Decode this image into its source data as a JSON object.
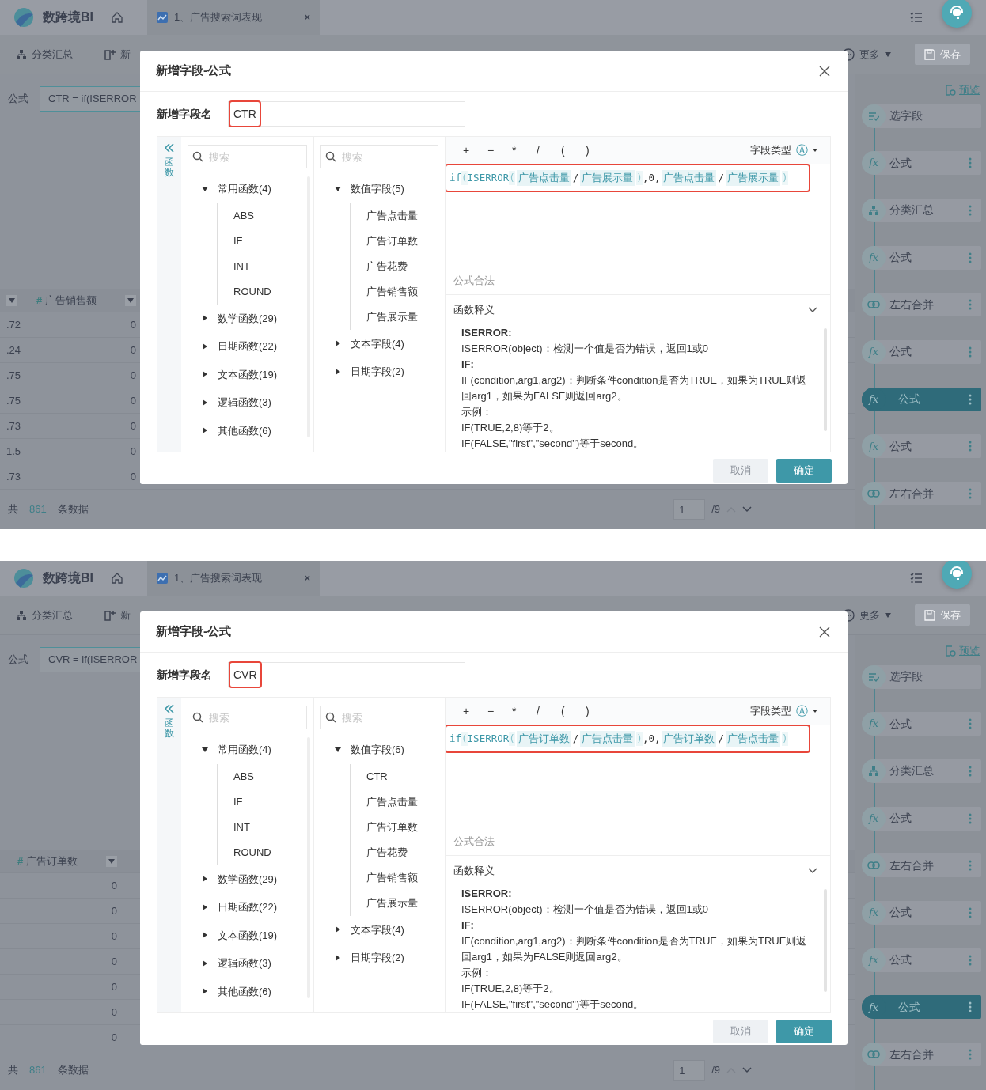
{
  "panels": [
    {
      "app": {
        "logo": "数跨境BI",
        "tab": "1、广告搜索词表现",
        "tab_close": "×"
      },
      "toolbar": {
        "items": [
          "分类汇总",
          "新"
        ],
        "more": "更多",
        "save": {
          "label": "保存",
          "disabled": true
        }
      },
      "formula_bar": {
        "label": "公式",
        "value": "CTR = if(ISERROR"
      },
      "table": {
        "column": {
          "type_mark": "#",
          "label": "广告销售额"
        },
        "rows": [
          {
            "cut_value": ".72",
            "value": "0"
          },
          {
            "cut_value": ".24",
            "value": "0"
          },
          {
            "cut_value": ".75",
            "value": "0"
          },
          {
            "cut_value": ".75",
            "value": "0"
          },
          {
            "cut_value": ".73",
            "value": "0"
          },
          {
            "cut_value": "1.5",
            "value": "0"
          },
          {
            "cut_value": ".73",
            "value": "0"
          }
        ]
      },
      "footer": {
        "prefix": "共",
        "count": "861",
        "suffix": "条数据",
        "page": "1",
        "total": "/9"
      },
      "pipeline": {
        "preview": "预览",
        "steps": [
          {
            "kind": "select",
            "label": "选字段",
            "selected": false
          },
          {
            "kind": "formula",
            "icon": "fx",
            "label": "公式",
            "selected": false
          },
          {
            "kind": "group",
            "label": "分类汇总",
            "selected": false
          },
          {
            "kind": "formula",
            "icon": "fx",
            "label": "公式",
            "selected": false
          },
          {
            "kind": "join",
            "label": "左右合并",
            "selected": false
          },
          {
            "kind": "formula",
            "icon": "fx",
            "label": "公式",
            "selected": false
          },
          {
            "kind": "formula",
            "icon": "fx",
            "label": "公式",
            "selected": true
          },
          {
            "kind": "formula",
            "icon": "fx",
            "label": "公式",
            "selected": false
          },
          {
            "kind": "join",
            "label": "左右合并",
            "selected": false
          }
        ]
      },
      "modal": {
        "title": "新增字段-公式",
        "name_label": "新增字段名",
        "name_value": "CTR",
        "functions": {
          "tab_label": "函数",
          "search_placeholder": "搜索",
          "groups": [
            {
              "label": "常用函数(4)",
              "expanded": true,
              "children": [
                {
                  "label": "ABS"
                },
                {
                  "label": "IF"
                },
                {
                  "label": "INT"
                },
                {
                  "label": "ROUND"
                }
              ]
            },
            {
              "label": "数学函数(29)",
              "expanded": false
            },
            {
              "label": "日期函数(22)",
              "expanded": false
            },
            {
              "label": "文本函数(19)",
              "expanded": false
            },
            {
              "label": "逻辑函数(3)",
              "expanded": false
            },
            {
              "label": "其他函数(6)",
              "expanded": false
            }
          ]
        },
        "fields": {
          "search_placeholder": "搜索",
          "groups": [
            {
              "label": "数值字段(5)",
              "expanded": true,
              "children": [
                {
                  "label": "广告点击量"
                },
                {
                  "label": "广告订单数"
                },
                {
                  "label": "广告花费"
                },
                {
                  "label": "广告销售额"
                },
                {
                  "label": "广告展示量"
                }
              ]
            },
            {
              "label": "文本字段(4)",
              "expanded": false
            },
            {
              "label": "日期字段(2)",
              "expanded": false
            }
          ]
        },
        "editor": {
          "operators": [
            "+",
            "−",
            "*",
            "/",
            "(",
            ")"
          ],
          "type_label": "字段类型",
          "type_icon": "Ⓐ",
          "formula": [
            {
              "kind": "func",
              "text": "if"
            },
            {
              "kind": "paren",
              "text": "("
            },
            {
              "kind": "func",
              "text": "ISERROR"
            },
            {
              "kind": "paren",
              "text": "("
            },
            {
              "kind": "field",
              "text": "广告点击量"
            },
            {
              "kind": "op",
              "text": "/"
            },
            {
              "kind": "field",
              "text": "广告展示量"
            },
            {
              "kind": "paren",
              "text": ")"
            },
            {
              "kind": "op",
              "text": ",0,"
            },
            {
              "kind": "field",
              "text": "广告点击量"
            },
            {
              "kind": "op",
              "text": "/"
            },
            {
              "kind": "field",
              "text": "广告展示量"
            },
            {
              "kind": "paren",
              "text": ")"
            }
          ],
          "status": "公式合法"
        },
        "help": {
          "title": "函数释义",
          "expanded": true,
          "lines": [
            {
              "kind": "heading",
              "text": "ISERROR:"
            },
            {
              "kind": "text",
              "text": "ISERROR(object)：检测一个值是否为错误，返回1或0"
            },
            {
              "kind": "heading",
              "text": "IF:"
            },
            {
              "kind": "text",
              "text": "IF(condition,arg1,arg2)：判断条件condition是否为TRUE，如果为TRUE则返回arg1，如果为FALSE则返回arg2。"
            },
            {
              "kind": "text",
              "text": "示例："
            },
            {
              "kind": "text",
              "text": "IF(TRUE,2,8)等于2。"
            },
            {
              "kind": "text",
              "text": "IF(FALSE,\"first\",\"second\")等于second。"
            }
          ]
        },
        "cancel": "取消",
        "ok": "确定"
      }
    },
    {
      "app": {
        "logo": "数跨境BI",
        "tab": "1、广告搜索词表现",
        "tab_close": "×"
      },
      "toolbar": {
        "items": [
          "分类汇总",
          "新"
        ],
        "more": "更多",
        "save": {
          "label": "保存",
          "disabled": true
        }
      },
      "formula_bar": {
        "label": "公式",
        "value": "CVR = if(ISERROR"
      },
      "table": {
        "column": {
          "type_mark": "#",
          "label": "广告订单数"
        },
        "rows": [
          {
            "value": "0"
          },
          {
            "value": "0"
          },
          {
            "value": "0"
          },
          {
            "value": "0"
          },
          {
            "value": "0"
          },
          {
            "value": "0"
          },
          {
            "value": "0"
          }
        ]
      },
      "footer": {
        "prefix": "共",
        "count": "861",
        "suffix": "条数据",
        "page": "1",
        "total": "/9"
      },
      "pipeline": {
        "preview": "预览",
        "steps": [
          {
            "kind": "select",
            "label": "选字段",
            "selected": false
          },
          {
            "kind": "formula",
            "icon": "fx",
            "label": "公式",
            "selected": false
          },
          {
            "kind": "group",
            "label": "分类汇总",
            "selected": false
          },
          {
            "kind": "formula",
            "icon": "fx",
            "label": "公式",
            "selected": false
          },
          {
            "kind": "join",
            "label": "左右合并",
            "selected": false
          },
          {
            "kind": "formula",
            "icon": "fx",
            "label": "公式",
            "selected": false
          },
          {
            "kind": "formula",
            "icon": "fx",
            "label": "公式",
            "selected": false
          },
          {
            "kind": "formula",
            "icon": "fx",
            "label": "公式",
            "selected": true
          },
          {
            "kind": "join",
            "label": "左右合并",
            "selected": false
          }
        ]
      },
      "modal": {
        "title": "新增字段-公式",
        "name_label": "新增字段名",
        "name_value": "CVR",
        "functions": {
          "tab_label": "函数",
          "search_placeholder": "搜索",
          "groups": [
            {
              "label": "常用函数(4)",
              "expanded": true,
              "children": [
                {
                  "label": "ABS"
                },
                {
                  "label": "IF"
                },
                {
                  "label": "INT"
                },
                {
                  "label": "ROUND"
                }
              ]
            },
            {
              "label": "数学函数(29)",
              "expanded": false
            },
            {
              "label": "日期函数(22)",
              "expanded": false
            },
            {
              "label": "文本函数(19)",
              "expanded": false
            },
            {
              "label": "逻辑函数(3)",
              "expanded": false
            },
            {
              "label": "其他函数(6)",
              "expanded": false
            }
          ]
        },
        "fields": {
          "search_placeholder": "搜索",
          "groups": [
            {
              "label": "数值字段(6)",
              "expanded": true,
              "children": [
                {
                  "label": "CTR"
                },
                {
                  "label": "广告点击量"
                },
                {
                  "label": "广告订单数"
                },
                {
                  "label": "广告花费"
                },
                {
                  "label": "广告销售额"
                },
                {
                  "label": "广告展示量"
                }
              ]
            },
            {
              "label": "文本字段(4)",
              "expanded": false
            },
            {
              "label": "日期字段(2)",
              "expanded": false
            }
          ]
        },
        "editor": {
          "operators": [
            "+",
            "−",
            "*",
            "/",
            "(",
            ")"
          ],
          "type_label": "字段类型",
          "type_icon": "Ⓐ",
          "formula": [
            {
              "kind": "func",
              "text": "if"
            },
            {
              "kind": "paren",
              "text": "("
            },
            {
              "kind": "func",
              "text": "ISERROR"
            },
            {
              "kind": "paren",
              "text": "("
            },
            {
              "kind": "field",
              "text": "广告订单数"
            },
            {
              "kind": "op",
              "text": "/"
            },
            {
              "kind": "field",
              "text": "广告点击量"
            },
            {
              "kind": "paren",
              "text": ")"
            },
            {
              "kind": "op",
              "text": ",0,"
            },
            {
              "kind": "field",
              "text": "广告订单数"
            },
            {
              "kind": "op",
              "text": "/"
            },
            {
              "kind": "field",
              "text": "广告点击量"
            },
            {
              "kind": "paren",
              "text": ")"
            }
          ],
          "status": "公式合法"
        },
        "help": {
          "title": "函数释义",
          "expanded": true,
          "lines": [
            {
              "kind": "heading",
              "text": "ISERROR:"
            },
            {
              "kind": "text",
              "text": "ISERROR(object)：检测一个值是否为错误，返回1或0"
            },
            {
              "kind": "heading",
              "text": "IF:"
            },
            {
              "kind": "text",
              "text": "IF(condition,arg1,arg2)：判断条件condition是否为TRUE，如果为TRUE则返回arg1，如果为FALSE则返回arg2。"
            },
            {
              "kind": "text",
              "text": "示例："
            },
            {
              "kind": "text",
              "text": "IF(TRUE,2,8)等于2。"
            },
            {
              "kind": "text",
              "text": "IF(FALSE,\"first\",\"second\")等于second。"
            }
          ]
        },
        "cancel": "取消",
        "ok": "确定"
      }
    }
  ]
}
